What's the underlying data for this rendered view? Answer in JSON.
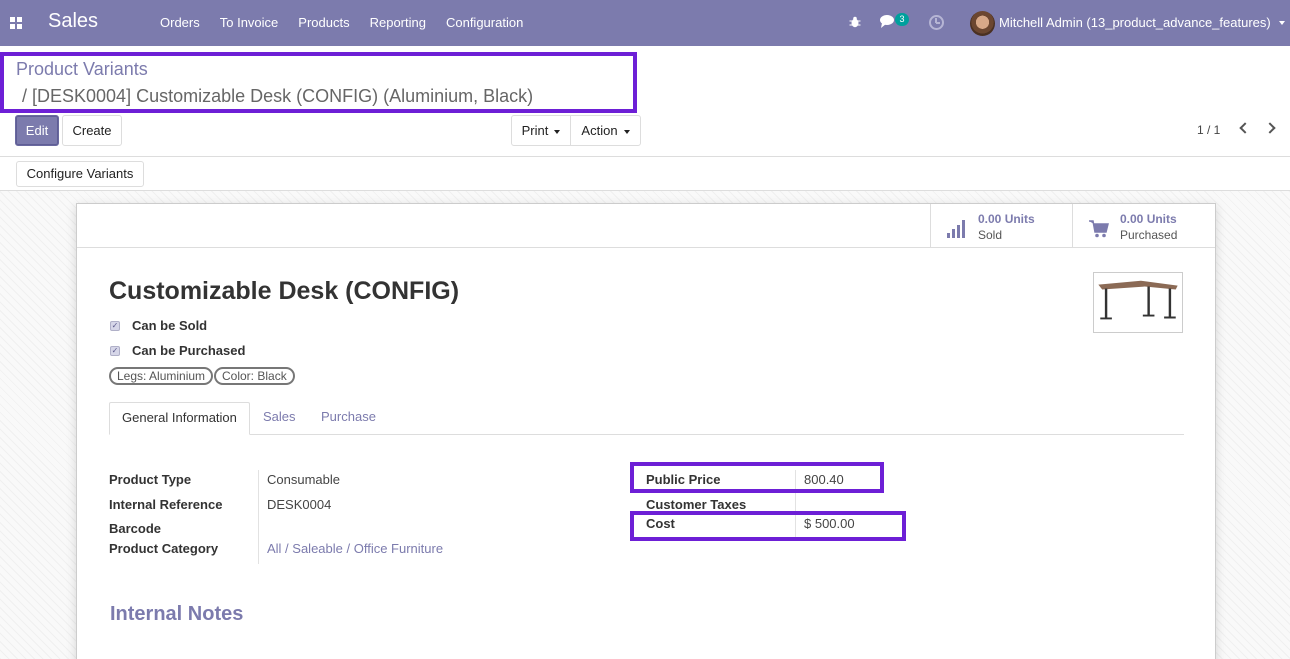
{
  "navbar": {
    "app_name": "Sales",
    "menu": [
      "Orders",
      "To Invoice",
      "Products",
      "Reporting",
      "Configuration"
    ],
    "chat_count": "3",
    "user": "Mitchell Admin (13_product_advance_features)",
    "icons": [
      "apps-icon",
      "bug-icon",
      "chat-icon",
      "clock-icon"
    ]
  },
  "breadcrumb": {
    "parent": "Product Variants",
    "current": "/ [DESK0004] Customizable Desk (CONFIG) (Aluminium, Black)"
  },
  "buttons": {
    "edit": "Edit",
    "create": "Create",
    "print": "Print",
    "action": "Action",
    "configure_variants": "Configure Variants"
  },
  "pager": {
    "value": "1 / 1"
  },
  "smart_buttons": {
    "sold": {
      "value": "0.00 Units",
      "label": "Sold"
    },
    "purchased": {
      "value": "0.00 Units",
      "label": "Purchased"
    }
  },
  "product": {
    "name": "Customizable Desk (CONFIG)",
    "can_be_sold": "Can be Sold",
    "can_be_purchased": "Can be Purchased",
    "attributes": [
      "Legs: Aluminium",
      "Color: Black"
    ]
  },
  "tabs": [
    "General Information",
    "Sales",
    "Purchase"
  ],
  "general_info": {
    "left": {
      "product_type_label": "Product Type",
      "product_type": "Consumable",
      "internal_ref_label": "Internal Reference",
      "internal_ref": "DESK0004",
      "barcode_label": "Barcode",
      "category_label": "Product Category",
      "category": "All / Saleable / Office Furniture"
    },
    "right": {
      "public_price_label": "Public Price",
      "public_price": "800.40",
      "customer_taxes_label": "Customer Taxes",
      "cost_label": "Cost",
      "cost": "$ 500.00"
    }
  },
  "internal_notes_title": "Internal Notes",
  "colors": {
    "brand": "#7c7bad",
    "highlight": "#6d1fd6",
    "badge": "#00a09d"
  }
}
